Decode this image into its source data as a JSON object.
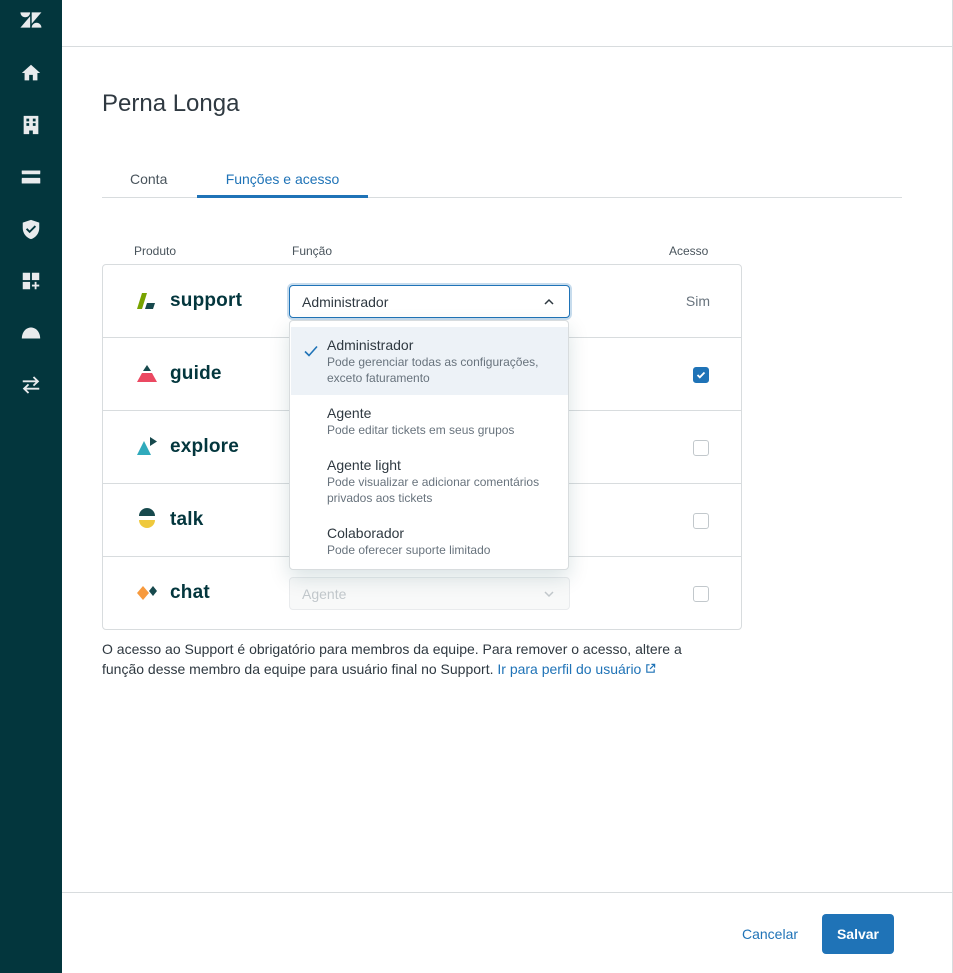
{
  "sidebar": {
    "icons": [
      "zendesk-logo-icon",
      "home-icon",
      "building-icon",
      "credit-card-icon",
      "shield-icon",
      "apps-add-icon",
      "dome-icon",
      "transfer-icon"
    ]
  },
  "page": {
    "title": "Perna Longa"
  },
  "tabs": [
    {
      "label": "Conta",
      "active": false
    },
    {
      "label": "Funções e acesso",
      "active": true
    }
  ],
  "table": {
    "headers": {
      "product": "Produto",
      "role": "Função",
      "access": "Acesso"
    },
    "rows": [
      {
        "product": "support",
        "role": "Administrador",
        "access": "Sim",
        "logo_colors": [
          "#78a300",
          "#17494d"
        ]
      },
      {
        "product": "guide",
        "checked": true,
        "logo_colors": [
          "#eb4962",
          "#17494d"
        ]
      },
      {
        "product": "explore",
        "checked": false,
        "logo_colors": [
          "#30aabc",
          "#17494d"
        ]
      },
      {
        "product": "talk",
        "checked": false,
        "logo_colors": [
          "#efc93d",
          "#17494d"
        ]
      },
      {
        "product": "chat",
        "role": "Agente",
        "checked": false,
        "logo_colors": [
          "#f79a3e",
          "#17494d"
        ]
      }
    ]
  },
  "dropdown": {
    "options": [
      {
        "title": "Administrador",
        "desc": "Pode gerenciar todas as configurações, exceto faturamento",
        "selected": true
      },
      {
        "title": "Agente",
        "desc": "Pode editar tickets em seus grupos",
        "selected": false
      },
      {
        "title": "Agente light",
        "desc": "Pode visualizar e adicionar comentários privados aos tickets",
        "selected": false
      },
      {
        "title": "Colaborador",
        "desc": "Pode oferecer suporte limitado",
        "selected": false
      }
    ]
  },
  "info": {
    "text": "O acesso ao Support é obrigatório para membros da equipe. Para remover o acesso, altere a função desse membro da equipe para usuário final no Support.",
    "link": "Ir para perfil do usuário"
  },
  "footer": {
    "cancel_label": "Cancelar",
    "save_label": "Salvar"
  },
  "colors": {
    "sidebar": "#03363d",
    "accent": "#1f73b7"
  }
}
